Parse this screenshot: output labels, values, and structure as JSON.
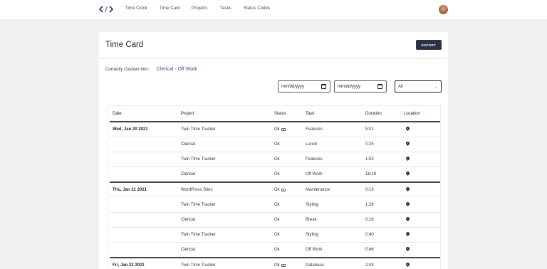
{
  "nav": {
    "items": [
      "Time Clock",
      "Time Card",
      "Projects",
      "Tasks",
      "Status Codes"
    ]
  },
  "card": {
    "title": "Time Card",
    "export_label": "EXPORT",
    "clocked_label": "Currently Clocked Into:",
    "clocked_value": "Clerical - Off Work"
  },
  "filters": {
    "start_date_placeholder": "mm/dd/yyyy",
    "end_date_placeholder": "mm/dd/yyyy",
    "status_selected": "All"
  },
  "table": {
    "columns": [
      "Date",
      "Project",
      "Status",
      "Task",
      "Duration",
      "Location"
    ],
    "rows": [
      {
        "date": "Wed, Jan 20 2021",
        "project": "Twin Time Tracker",
        "status": "Ok",
        "note": true,
        "task": "Features",
        "duration": "5:01"
      },
      {
        "date": "",
        "project": "Clerical",
        "status": "Ok",
        "note": false,
        "task": "Lunch",
        "duration": "0:25"
      },
      {
        "date": "",
        "project": "Twin Time Tracker",
        "status": "Ok",
        "note": false,
        "task": "Features",
        "duration": "1:53"
      },
      {
        "date": "",
        "project": "Clerical",
        "status": "Ok",
        "note": false,
        "task": "Off Work",
        "duration": "16:19"
      },
      {
        "date": "Thu, Jan 21 2021",
        "project": "WordPress Sites",
        "status": "Ok",
        "note": true,
        "task": "Maintenance",
        "duration": "0:13"
      },
      {
        "date": "",
        "project": "Twin Time Tracker",
        "status": "Ok",
        "note": false,
        "task": "Styling",
        "duration": "1:28"
      },
      {
        "date": "",
        "project": "Clerical",
        "status": "Ok",
        "note": false,
        "task": "Break",
        "duration": "0:16"
      },
      {
        "date": "",
        "project": "Twin Time Tracker",
        "status": "Ok",
        "note": false,
        "task": "Styling",
        "duration": "0:40"
      },
      {
        "date": "",
        "project": "Clerical",
        "status": "Ok",
        "note": false,
        "task": "Off Work",
        "duration": "0:46"
      },
      {
        "date": "Fri, Jan 22 2021",
        "project": "Twin Time Tracker",
        "status": "Ok",
        "note": true,
        "task": "Database",
        "duration": "2:43"
      }
    ]
  },
  "colors": {
    "accent": "#3f3fa8",
    "button": "#2b3342",
    "background": "#f1f1f2"
  }
}
